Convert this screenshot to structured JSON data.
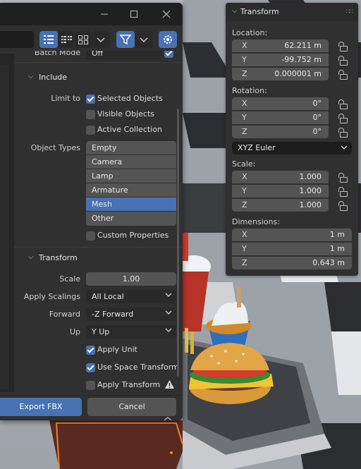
{
  "dialog": {
    "window_controls": {
      "minimize_icon": "minimize-icon",
      "maximize_icon": "maximize-icon",
      "close_icon": "close-icon"
    },
    "toolbar": {
      "view_buttons": [
        "vertical-list-icon",
        "horizontal-list-icon",
        "thumbnails-icon"
      ],
      "filter_icon": "filter-icon",
      "settings_icon": "gear-icon"
    },
    "batch_mode": {
      "label": "Batch Mode",
      "value": "Off"
    },
    "include": {
      "title": "Include",
      "limit_to_label": "Limit to",
      "selected_objects": {
        "label": "Selected Objects",
        "checked": true
      },
      "visible_objects": {
        "label": "Visible Objects",
        "checked": false
      },
      "active_collection": {
        "label": "Active Collection",
        "checked": false
      },
      "object_types_label": "Object Types",
      "object_types": [
        {
          "label": "Empty",
          "selected": false
        },
        {
          "label": "Camera",
          "selected": false
        },
        {
          "label": "Lamp",
          "selected": false
        },
        {
          "label": "Armature",
          "selected": false
        },
        {
          "label": "Mesh",
          "selected": true
        },
        {
          "label": "Other",
          "selected": false
        }
      ],
      "custom_properties": {
        "label": "Custom Properties",
        "checked": false
      }
    },
    "transform": {
      "title": "Transform",
      "scale": {
        "label": "Scale",
        "value": "1.00"
      },
      "apply_scalings": {
        "label": "Apply Scalings",
        "value": "All Local"
      },
      "forward": {
        "label": "Forward",
        "value": "-Z Forward"
      },
      "up": {
        "label": "Up",
        "value": "Y Up"
      },
      "apply_unit": {
        "label": "Apply Unit",
        "checked": true
      },
      "use_space_transform": {
        "label": "Use Space Transform",
        "checked": true
      },
      "apply_transform": {
        "label": "Apply Transform",
        "checked": false,
        "warning_icon": "warning-icon"
      }
    },
    "export_button": "Export FBX",
    "cancel_button": "Cancel"
  },
  "npanel": {
    "title": "Transform",
    "location": {
      "label": "Location:",
      "x": {
        "axis": "X",
        "value": "62.211 m"
      },
      "y": {
        "axis": "Y",
        "value": "-99.752 m"
      },
      "z": {
        "axis": "Z",
        "value": "0.000001 m"
      }
    },
    "rotation": {
      "label": "Rotation:",
      "x": {
        "axis": "X",
        "value": "0°"
      },
      "y": {
        "axis": "Y",
        "value": "0°"
      },
      "z": {
        "axis": "Z",
        "value": "0°"
      },
      "mode": "XYZ Euler"
    },
    "scale": {
      "label": "Scale:",
      "x": {
        "axis": "X",
        "value": "1.000"
      },
      "y": {
        "axis": "Y",
        "value": "1.000"
      },
      "z": {
        "axis": "Z",
        "value": "1.000"
      }
    },
    "dimensions": {
      "label": "Dimensions:",
      "x": {
        "axis": "X",
        "value": "1 m"
      },
      "y": {
        "axis": "Y",
        "value": "1 m"
      },
      "z": {
        "axis": "Z",
        "value": "0.643 m"
      }
    }
  },
  "colors": {
    "accent": "#4772b3",
    "panel_bg": "#303030",
    "field_bg": "#545454",
    "dark_field_bg": "#2a2a2a"
  }
}
